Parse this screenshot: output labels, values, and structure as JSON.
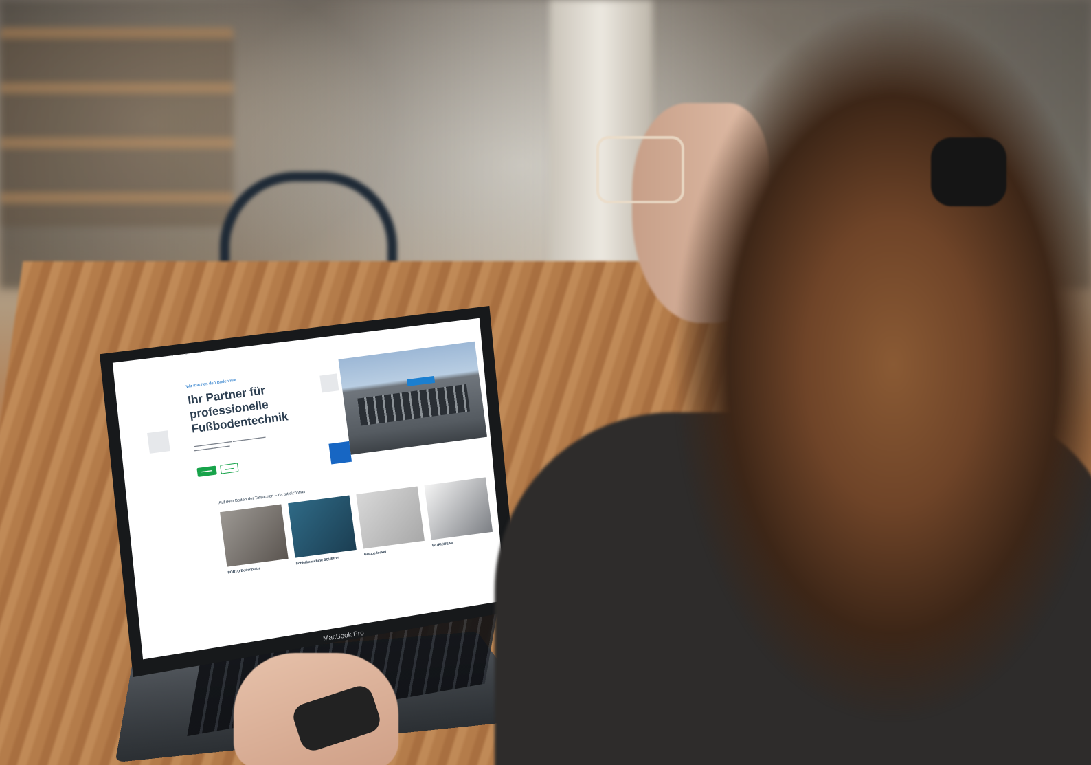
{
  "scene": {
    "description_colors": {
      "wood": "#b47c4a",
      "laptop": "#17191b",
      "accent_green": "#17a34a",
      "accent_blue": "#1766c3"
    }
  },
  "laptop": {
    "brand_label": "MacBook Pro"
  },
  "website": {
    "eyebrow": "Wir machen den Boden klar",
    "headline": "Ihr Partner für professionelle Fußbodentechnik",
    "section_title": "Auf dem Boden der Tatsachen – da tut sich was",
    "cards": [
      {
        "label": "PORTO Bodenplatte"
      },
      {
        "label": "Schleifmaschine SCHEIDE"
      },
      {
        "label": "Glaubedeckel"
      },
      {
        "label": "WORKWEAR"
      }
    ]
  }
}
